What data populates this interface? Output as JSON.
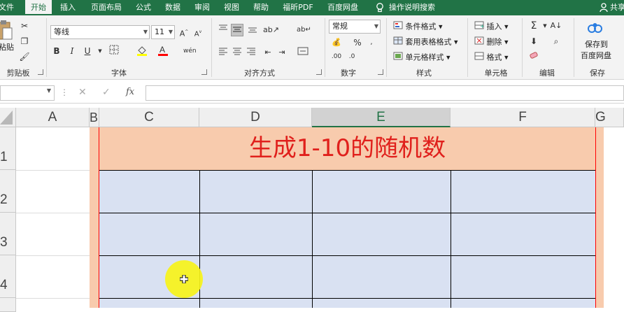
{
  "tabs": [
    {
      "label": "文件",
      "active": false
    },
    {
      "label": "开始",
      "active": true
    },
    {
      "label": "插入",
      "active": false
    },
    {
      "label": "页面布局",
      "active": false
    },
    {
      "label": "公式",
      "active": false
    },
    {
      "label": "数据",
      "active": false
    },
    {
      "label": "审阅",
      "active": false
    },
    {
      "label": "视图",
      "active": false
    },
    {
      "label": "帮助",
      "active": false
    },
    {
      "label": "福昕PDF",
      "active": false
    },
    {
      "label": "百度网盘",
      "active": false
    }
  ],
  "tell_me": "操作说明搜索",
  "share": "共享",
  "clipboard": {
    "paste": "粘贴",
    "group": "剪贴板"
  },
  "font": {
    "name": "等线",
    "size": "11",
    "group": "字体"
  },
  "alignment": {
    "group": "对齐方式"
  },
  "number": {
    "format": "常规",
    "group": "数字"
  },
  "styles": {
    "conditional": "条件格式",
    "table": "套用表格格式",
    "cell": "单元格样式",
    "group": "样式"
  },
  "cells": {
    "insert": "插入",
    "delete": "删除",
    "format": "格式",
    "group": "单元格"
  },
  "editing": {
    "group": "编辑"
  },
  "save": {
    "line1": "保存到",
    "line2": "百度网盘",
    "group": "保存"
  },
  "formula_bar": {
    "fx": "fx",
    "content": ""
  },
  "columns": [
    "A",
    "B",
    "C",
    "D",
    "E",
    "F",
    "G"
  ],
  "selected_column": "E",
  "rows": [
    "1",
    "2",
    "3",
    "4"
  ],
  "title_cell": "生成1-10的随机数",
  "colors": {
    "excel_green": "#217346",
    "title_fill": "#f8cbad",
    "title_text": "#e0201c",
    "table_fill": "#d9e1f2",
    "border_red": "#ff0000",
    "cursor_highlight": "#f7f31a"
  }
}
